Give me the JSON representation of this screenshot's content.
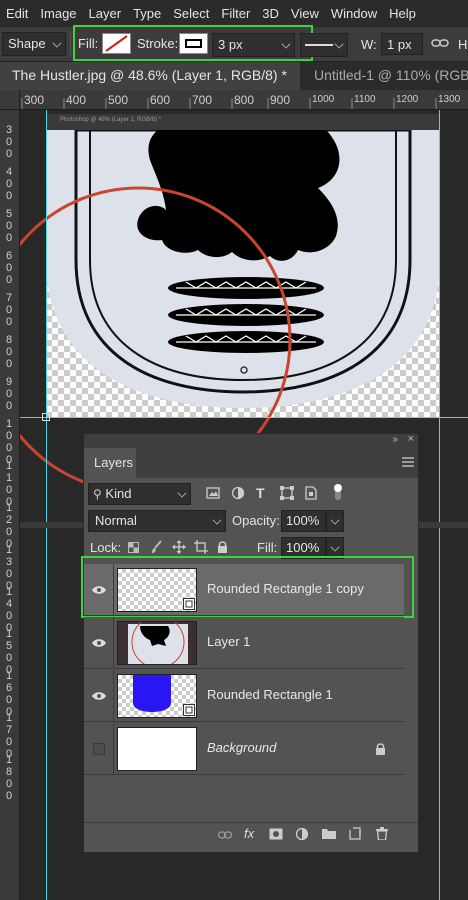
{
  "menu": [
    "Edit",
    "Image",
    "Layer",
    "Type",
    "Select",
    "Filter",
    "3D",
    "View",
    "Window",
    "Help"
  ],
  "options": {
    "tool_mode": "Shape",
    "fill_label": "Fill:",
    "stroke_label": "Stroke:",
    "stroke_width": "3 px",
    "width_label": "W:",
    "width_value": "1 px",
    "overflow_label": "H"
  },
  "tabs": [
    {
      "label": "The Hustler.jpg @ 48.6% (Layer 1, RGB/8) *",
      "active": true
    },
    {
      "label": "Untitled-1 @ 110% (RGB",
      "active": false
    }
  ],
  "ruler": {
    "h_ticks": [
      "300",
      "400",
      "500",
      "600",
      "700",
      "800",
      "900",
      "1000",
      "1100",
      "1200",
      "1300"
    ],
    "v_groups": [
      [
        "3",
        "0",
        "0"
      ],
      [
        "4",
        "0",
        "0"
      ],
      [
        "5",
        "0",
        "0"
      ],
      [
        "6",
        "0",
        "0"
      ],
      [
        "7",
        "0",
        "0"
      ],
      [
        "8",
        "0",
        "0"
      ],
      [
        "9",
        "0",
        "0"
      ],
      [
        "1",
        "0",
        "0",
        "0"
      ],
      [
        "1",
        "1",
        "0",
        "0"
      ],
      [
        "1",
        "2",
        "0",
        "0"
      ],
      [
        "1",
        "3",
        "0",
        "0"
      ],
      [
        "1",
        "4",
        "0",
        "0"
      ],
      [
        "1",
        "5",
        "0",
        "0"
      ],
      [
        "1",
        "6",
        "0",
        "0"
      ],
      [
        "1",
        "7",
        "0",
        "0"
      ],
      [
        "1",
        "8",
        "0",
        "0"
      ]
    ]
  },
  "doc_caption": "Photoshop @ 48% (Layer 1, RGB/8) *",
  "layers_panel": {
    "title": "Layers",
    "filter_kind": "Kind",
    "blend_mode": "Normal",
    "opacity_label": "Opacity:",
    "opacity_value": "100%",
    "lock_label": "Lock:",
    "fill_label": "Fill:",
    "fill_value": "100%",
    "layers": [
      {
        "name": "Rounded Rectangle 1 copy",
        "visible": true,
        "selected": true
      },
      {
        "name": "Layer 1",
        "visible": true,
        "selected": false
      },
      {
        "name": "Rounded Rectangle 1",
        "visible": true,
        "selected": false
      },
      {
        "name": "Background",
        "visible": false,
        "selected": false,
        "locked": true
      }
    ],
    "footer_icons": [
      "link-icon",
      "fx-icon",
      "mask-icon",
      "adjustment-icon",
      "folder-icon",
      "new-layer-icon",
      "trash-icon"
    ]
  },
  "colors": {
    "highlight": "#39d639",
    "guide": "#4fd6e6",
    "circle": "#c8452f",
    "shield_fill": "#dde2ea",
    "layer_blue": "#2a16f2"
  }
}
